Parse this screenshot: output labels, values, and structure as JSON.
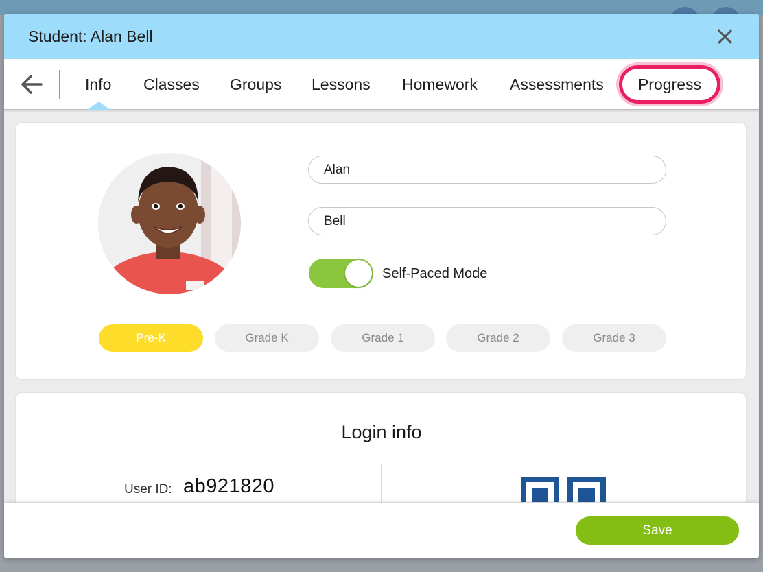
{
  "modal": {
    "title": "Student: Alan Bell"
  },
  "tabs": [
    {
      "label": "Info"
    },
    {
      "label": "Classes"
    },
    {
      "label": "Groups"
    },
    {
      "label": "Lessons"
    },
    {
      "label": "Homework"
    },
    {
      "label": "Assessments"
    },
    {
      "label": "Progress"
    }
  ],
  "profile": {
    "first_name": "Alan",
    "last_name": "Bell",
    "self_paced_label": "Self-Paced Mode",
    "self_paced_on": true,
    "grades": [
      {
        "label": "Pre-K",
        "selected": true
      },
      {
        "label": "Grade K",
        "selected": false
      },
      {
        "label": "Grade 1",
        "selected": false
      },
      {
        "label": "Grade 2",
        "selected": false
      },
      {
        "label": "Grade 3",
        "selected": false
      }
    ]
  },
  "login": {
    "title": "Login info",
    "user_id_label": "User ID:",
    "user_id": "ab921820"
  },
  "footer": {
    "save_label": "Save"
  },
  "colors": {
    "header_bg": "#9edcfb",
    "highlight_ring": "#ea1f63",
    "toggle_on": "#8cc63f",
    "grade_selected": "#fddd2a",
    "save_button": "#84bd14",
    "qr_blue": "#1f5596"
  },
  "icons": {
    "back": "arrow-left-icon",
    "close": "close-icon",
    "qr": "qr-code-icon"
  }
}
